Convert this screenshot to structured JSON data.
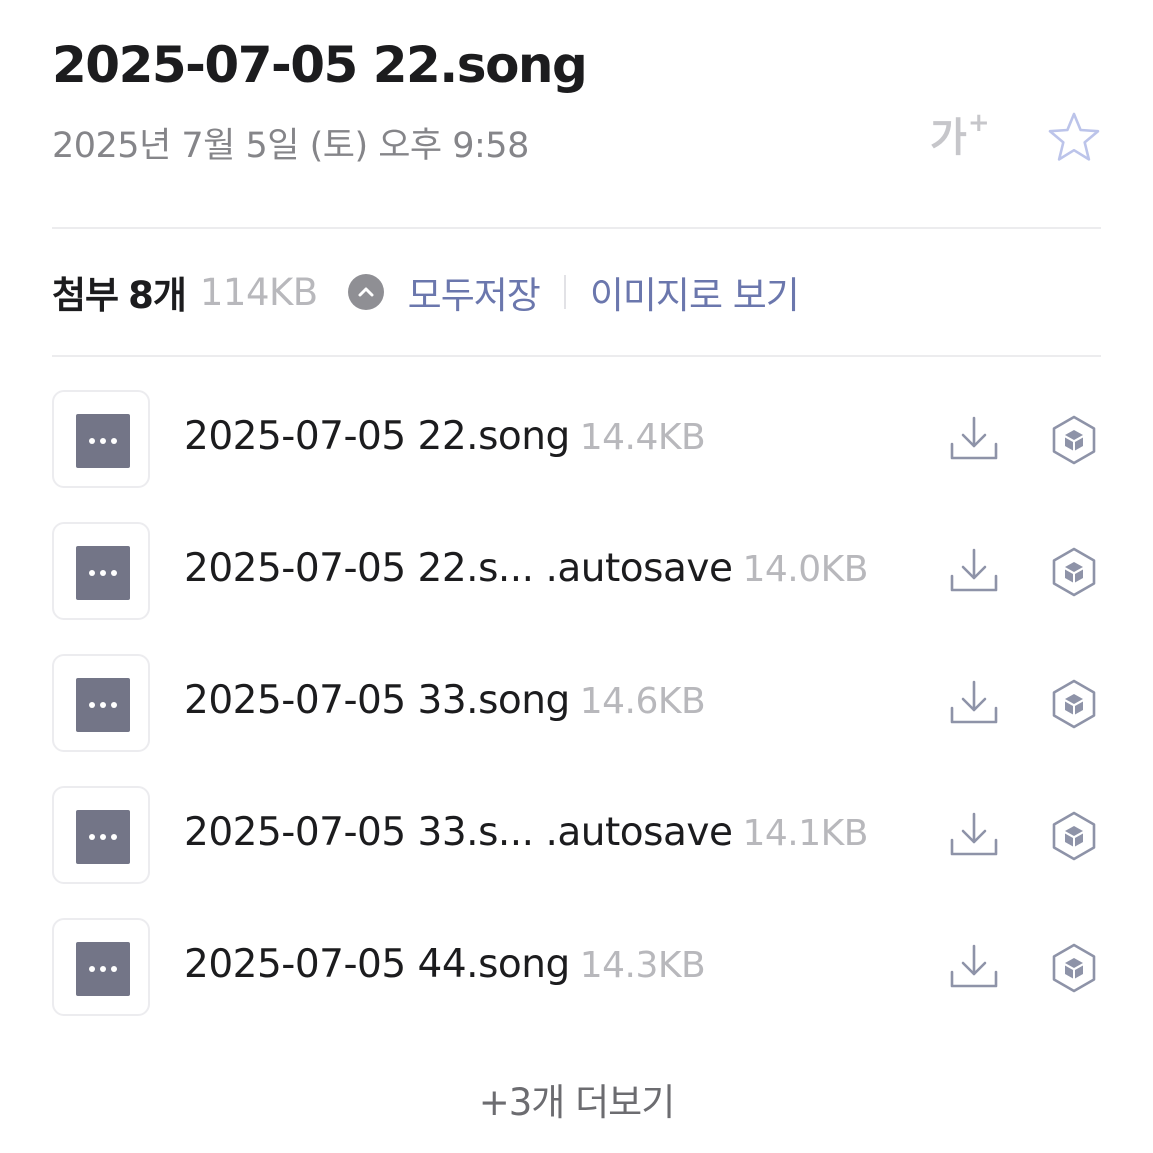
{
  "header": {
    "title": "2025-07-05 22.song",
    "date": "2025년 7월 5일 (토) 오후 9:58",
    "font_size_button": {
      "label": "가",
      "sup": "+",
      "icon": "font-size-increase-icon"
    },
    "star_button": {
      "icon": "star-outline-icon"
    }
  },
  "attachments": {
    "label": "첨부",
    "count": "8개",
    "total_size": "114KB",
    "collapse_icon": "chevron-up-icon",
    "save_all": "모두저장",
    "view_as_images": "이미지로 보기",
    "files": [
      {
        "name": "2025-07-05 22.song",
        "size": "14.4KB",
        "icon": "file-generic-icon"
      },
      {
        "name": "2025-07-05 22.s... .autosave",
        "size": "14.0KB",
        "icon": "file-generic-icon"
      },
      {
        "name": "2025-07-05 33.song",
        "size": "14.6KB",
        "icon": "file-generic-icon"
      },
      {
        "name": "2025-07-05 33.s...  .autosave",
        "size": "14.1KB",
        "icon": "file-generic-icon"
      },
      {
        "name": "2025-07-05 44.song",
        "size": "14.3KB",
        "icon": "file-generic-icon"
      }
    ],
    "row_icons": {
      "download": "download-icon",
      "cloud": "cloud-box-icon"
    },
    "more_label": "+3개 더보기"
  },
  "colors": {
    "title": "#1c1c1e",
    "date": "#858589",
    "accent_link": "#6b77ad",
    "muted": "#b8b8bc",
    "file_icon_fill": "#737587",
    "divider": "#ececee"
  }
}
